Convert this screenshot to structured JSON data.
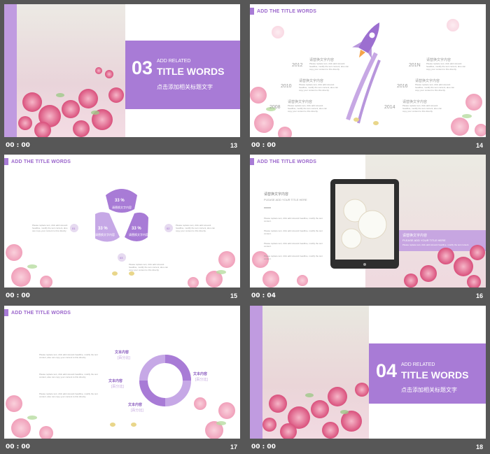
{
  "slides": [
    {
      "time": "00 : 00",
      "num": "13",
      "section_num": "03",
      "add_related": "ADD RELATED",
      "title_words": "TITLE WORDS",
      "subtitle": "点击添加相关标题文字"
    },
    {
      "time": "00 : 00",
      "num": "14",
      "header": "ADD THE TITLE WORDS",
      "years": [
        "2012",
        "2010",
        "2008",
        "201N",
        "2016",
        "2014"
      ],
      "item_title": "请替换文字内容",
      "item_text": "Please replace text, click add relevant headline, modify the text content, also can copy your content to this directly."
    },
    {
      "time": "00 : 00",
      "num": "15",
      "header": "ADD THE TITLE WORDS",
      "pct_labels": [
        "33 %",
        "33 %",
        "33 %"
      ],
      "pct_sub": "请替换文字内容",
      "circle_nums": [
        "01",
        "02",
        "03"
      ],
      "text_block": "Please replace text, click add relevant headline, modify the text content, also can copy your content to this directly."
    },
    {
      "time": "00 : 04",
      "num": "16",
      "header": "ADD THE TITLE WORDS",
      "left_title": "请替换文字内容",
      "left_sub": "PLEASE ADD YOUR TITLE HERE",
      "right_title": "请替换文字内容",
      "right_sub": "PLEASE ADD YOUR TITLE HERE",
      "para": "Please replace text, click add relevant headline, modify the text content."
    },
    {
      "time": "00 : 00",
      "num": "17",
      "header": "ADD THE TITLE WORDS",
      "labels": [
        "文本内容",
        "文本内容",
        "文本内容",
        "文本内容"
      ],
      "pct_tag": "[百分比]",
      "para": "Please replace text, click add relevant headline, modify the text content, also can copy your content to this directly."
    },
    {
      "time": "00 : 00",
      "num": "18",
      "section_num": "04",
      "add_related": "ADD RELATED",
      "title_words": "TITLE WORDS",
      "subtitle": "点击添加相关标题文字"
    }
  ],
  "colors": {
    "accent": "#a87bd6",
    "accent_dark": "#8a5cbf",
    "background": "#575757",
    "pink": "#f0a6bf"
  }
}
